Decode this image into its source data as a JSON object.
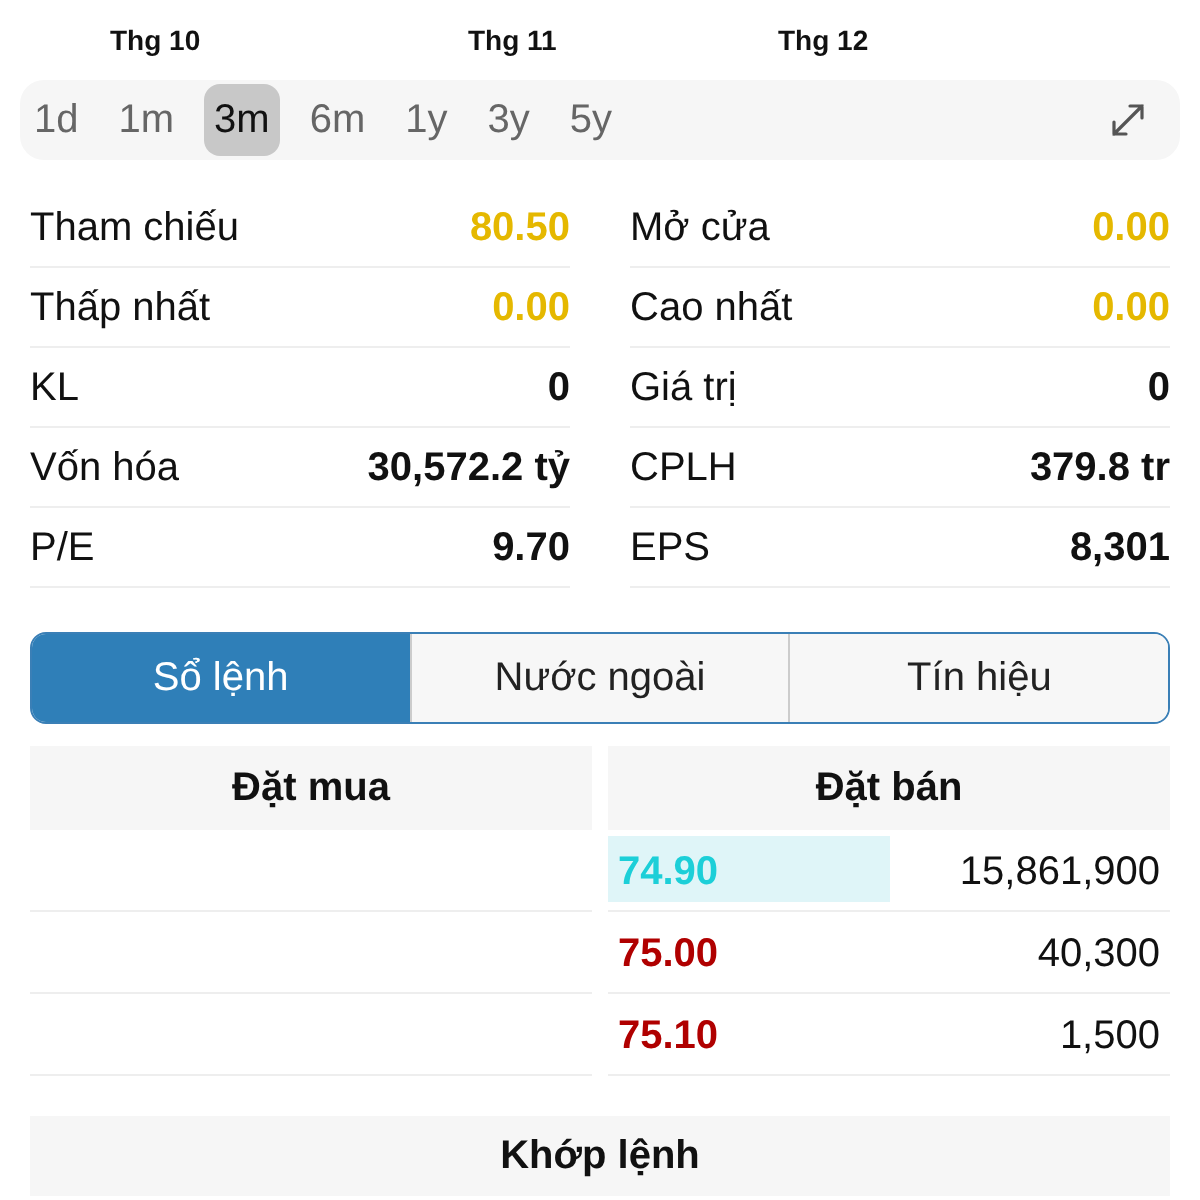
{
  "chart_months": [
    "Thg 10",
    "Thg 11",
    "Thg 12"
  ],
  "periods": [
    {
      "label": "1d",
      "selected": false
    },
    {
      "label": "1m",
      "selected": false
    },
    {
      "label": "3m",
      "selected": true
    },
    {
      "label": "6m",
      "selected": false
    },
    {
      "label": "1y",
      "selected": false
    },
    {
      "label": "3y",
      "selected": false
    },
    {
      "label": "5y",
      "selected": false
    }
  ],
  "stats": [
    {
      "label": "Tham chiếu",
      "value": "80.50",
      "color": "#e5b800"
    },
    {
      "label": "Mở cửa",
      "value": "0.00",
      "color": "#e5b800"
    },
    {
      "label": "Thấp nhất",
      "value": "0.00",
      "color": "#e5b800"
    },
    {
      "label": "Cao nhất",
      "value": "0.00",
      "color": "#e5b800"
    },
    {
      "label": "KL",
      "value": "0",
      "color": "#111111"
    },
    {
      "label": "Giá trị",
      "value": "0",
      "color": "#111111"
    },
    {
      "label": "Vốn hóa",
      "value": "30,572.2 tỷ",
      "color": "#111111"
    },
    {
      "label": "CPLH",
      "value": "379.8 tr",
      "color": "#111111"
    },
    {
      "label": "P/E",
      "value": "9.70",
      "color": "#111111"
    },
    {
      "label": "EPS",
      "value": "8,301",
      "color": "#111111"
    }
  ],
  "tabs": [
    {
      "label": "Sổ lệnh",
      "selected": true
    },
    {
      "label": "Nước ngoài",
      "selected": false
    },
    {
      "label": "Tín hiệu",
      "selected": false
    }
  ],
  "order_book": {
    "columns": [
      "Đặt mua",
      "Đặt bán"
    ],
    "asks": [
      {
        "price": "74.90",
        "volume": "15,861,900",
        "color": "#1ccfd8",
        "level": 0.5
      },
      {
        "price": "75.00",
        "volume": "40,300",
        "color": "#b00000"
      },
      {
        "price": "75.10",
        "volume": "1,500",
        "color": "#b00000"
      }
    ]
  },
  "matched": {
    "title": "Khớp lệnh"
  }
}
